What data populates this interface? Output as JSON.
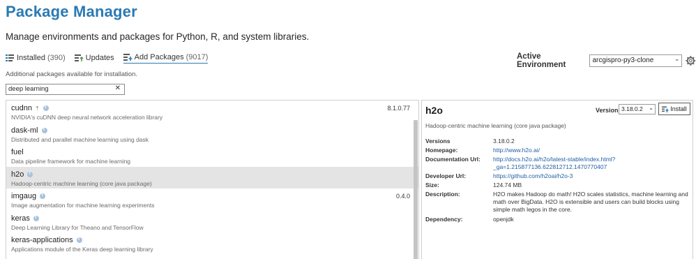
{
  "header": {
    "title": "Package Manager",
    "subtitle": "Manage environments and packages for Python, R, and system libraries."
  },
  "tabs": [
    {
      "label": "Installed",
      "count": "(390)",
      "icon": "installed-list-icon"
    },
    {
      "label": "Updates",
      "count": "",
      "icon": "updates-list-icon"
    },
    {
      "label": "Add Packages",
      "count": "(9017)",
      "icon": "add-packages-icon"
    }
  ],
  "environment": {
    "label": "Active Environment",
    "value": "arcgispro-py3-clone",
    "gear_icon": "gear-icon"
  },
  "search": {
    "hint": "Additional packages available for installation.",
    "value": "deep learning",
    "clear": "✕"
  },
  "packages": [
    {
      "name": "cudnn",
      "desc": "NVIDIA's cuDNN deep neural network acceleration library",
      "version": "8.1.0.77",
      "update_icon": true
    },
    {
      "name": "dask-ml",
      "desc": "Distributed and parallel machine learning using dask",
      "version": ""
    },
    {
      "name": "fuel",
      "desc": "Data pipeline framework for machine learning",
      "version": ""
    },
    {
      "name": "h2o",
      "desc": "Hadoop-centric machine learning (core java package)",
      "version": "",
      "selected": true
    },
    {
      "name": "imgaug",
      "desc": "Image augmentation for machine learning experiments",
      "version": "0.4.0"
    },
    {
      "name": "keras",
      "desc": "Deep Learning Library for Theano and TensorFlow",
      "version": ""
    },
    {
      "name": "keras-applications",
      "desc": "Applications module of the Keras deep learning library",
      "version": ""
    }
  ],
  "detail": {
    "name": "h2o",
    "version_label": "Version:",
    "version_value": "3.18.0.2",
    "install_label": "Install",
    "short_desc": "Hadoop-centric machine learning (core java package)",
    "fields": {
      "versions_label": "Versions",
      "versions_value": "3.18.0.2",
      "homepage_label": "Homepage:",
      "homepage_value": "http://www.h2o.ai/",
      "doc_label": "Documentation Url:",
      "doc_value": "http://docs.h2o.ai/h2o/latest-stable/index.html?_ga=1.215877136.622812712.1470770407",
      "dev_label": "Developer Url:",
      "dev_value": "https://github.com/h2oai/h2o-3",
      "size_label": "Size:",
      "size_value": "124.74 MB",
      "description_label": "Description:",
      "description_value": "H2O makes Hadoop do math! H2O scales statistics, machine learning and math over BigData. H2O is extensible and users can build blocks using simple math legos in the core.",
      "dependency_label": "Dependency:",
      "dependency_value": "openjdk"
    }
  },
  "colors": {
    "title": "#2a7ab3",
    "link": "#1f5fa5",
    "selected_row": "#e4e4e4"
  }
}
